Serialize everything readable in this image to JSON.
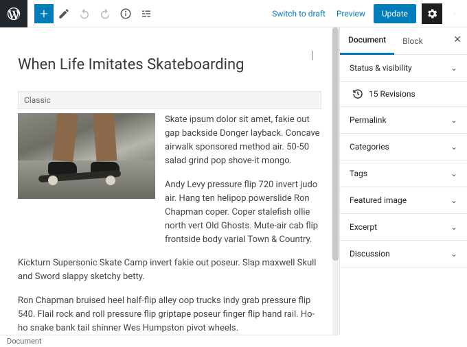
{
  "topbar": {
    "switch_to_draft": "Switch to draft",
    "preview": "Preview",
    "update": "Update"
  },
  "post": {
    "title": "When Life Imitates Skateboarding",
    "classic_block_label": "Classic",
    "paragraphs": [
      "Skate ipsum dolor sit amet, fakie out gap backside Donger layback. Concave airwalk sponsored method air. 50-50 salad grind pop shove-it mongo.",
      "Andy Levy pressure flip 720 invert judo air. Hang ten helipop powerslide Ron Chapman coper. Coper stalefish ollie north vert Old Ghosts. Mute-air cab flip frontside body varial Town & Country.",
      "Kickturn Supersonic Skate Camp invert fakie out poseur. Slap maxwell Skull and Sword slappy sketchy betty.",
      "Ron Chapman bruised heel half-flip alley oop trucks indy grab pressure flip 540. Flail rock and roll pressure flip griptape poseur finger flip hand rail. Ho-ho snake bank tail shinner Wes Humpston pivot wheels."
    ]
  },
  "sidebar": {
    "tabs": {
      "document": "Document",
      "block": "Block"
    },
    "panels": {
      "status": "Status & visibility",
      "revisions_count": "15 Revisions",
      "permalink": "Permalink",
      "categories": "Categories",
      "tags": "Tags",
      "featured_image": "Featured image",
      "excerpt": "Excerpt",
      "discussion": "Discussion"
    }
  },
  "footer": {
    "breadcrumb": "Document"
  }
}
